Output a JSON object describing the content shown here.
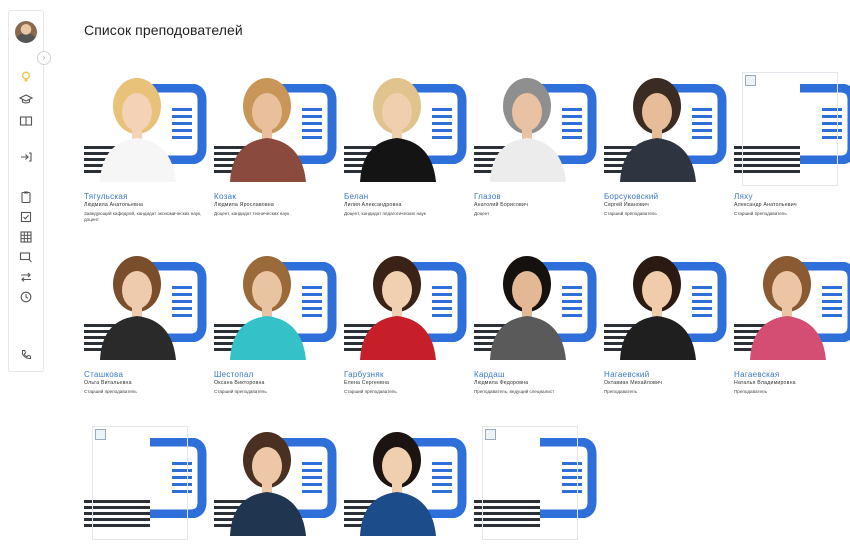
{
  "page": {
    "title": "Список преподователей"
  },
  "sidebar": {
    "icons": [
      "avatar",
      "lightbulb-icon",
      "graduation-cap-icon",
      "book-icon",
      "login-icon",
      "clipboard-icon",
      "checklist-icon",
      "grid-icon",
      "monitor-icon",
      "swap-icon",
      "clock-icon",
      "phone-icon"
    ],
    "collapse_label": "›"
  },
  "colors": {
    "brand_blue": "#2f6fd9",
    "link_blue": "#3a78c9",
    "stripe_dark": "#2b2f36"
  },
  "teachers": [
    {
      "surname": "Тягульская",
      "name": "Людмила Анатольевна",
      "position": "Заведующий кафедрой, кандидат экономических наук, доцент",
      "photo": true
    },
    {
      "surname": "Козак",
      "name": "Людмила Ярославовна",
      "position": "Доцент, кандидат технических наук",
      "photo": true
    },
    {
      "surname": "Белан",
      "name": "Лилия Александровна",
      "position": "Доцент, кандидат педагогических наук",
      "photo": true
    },
    {
      "surname": "Глазов",
      "name": "Анатолий Борисович",
      "position": "Доцент",
      "photo": true
    },
    {
      "surname": "Борсуковский",
      "name": "Сергей Иванович",
      "position": "Старший преподаватель",
      "photo": true
    },
    {
      "surname": "Ляху",
      "name": "Александр Анатольевич",
      "position": "Старший преподаватель",
      "photo": false
    },
    {
      "surname": "Сташкова",
      "name": "Ольга Витальевна",
      "position": "Старший преподаватель",
      "photo": true
    },
    {
      "surname": "Шестопал",
      "name": "Оксана Викторовна",
      "position": "Старший преподаватель",
      "photo": true
    },
    {
      "surname": "Гарбузняк",
      "name": "Елена Сергеевна",
      "position": "Старший преподаватель",
      "photo": true
    },
    {
      "surname": "Кардаш",
      "name": "Людмила Федоровна",
      "position": "Преподаватель, ведущий специалист",
      "photo": true
    },
    {
      "surname": "Нагаевский",
      "name": "Октавиан Михайлович",
      "position": "Преподаватель",
      "photo": true
    },
    {
      "surname": "Нагаевская",
      "name": "Наталья Владимировна",
      "position": "Преподаватель",
      "photo": true
    },
    {
      "surname": "",
      "name": "",
      "position": "",
      "photo": false
    },
    {
      "surname": "",
      "name": "",
      "position": "",
      "photo": true
    },
    {
      "surname": "",
      "name": "",
      "position": "",
      "photo": true
    },
    {
      "surname": "",
      "name": "",
      "position": "",
      "photo": false
    }
  ]
}
